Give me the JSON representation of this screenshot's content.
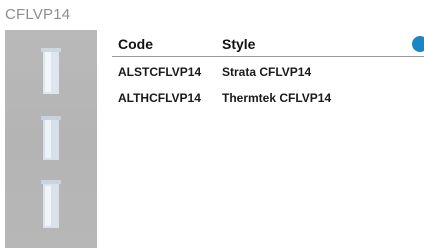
{
  "page": {
    "title": "CFLVP14"
  },
  "table": {
    "headers": {
      "code": "Code",
      "style": "Style"
    },
    "rows": [
      {
        "code": "ALSTCFLVP14",
        "style": "Strata CFLVP14"
      },
      {
        "code": "ALTHCFLVP14",
        "style": "Thermtek CFLVP14"
      }
    ]
  },
  "colors": {
    "accent": "#1a86c4",
    "image_background": "#b7b7b7"
  }
}
